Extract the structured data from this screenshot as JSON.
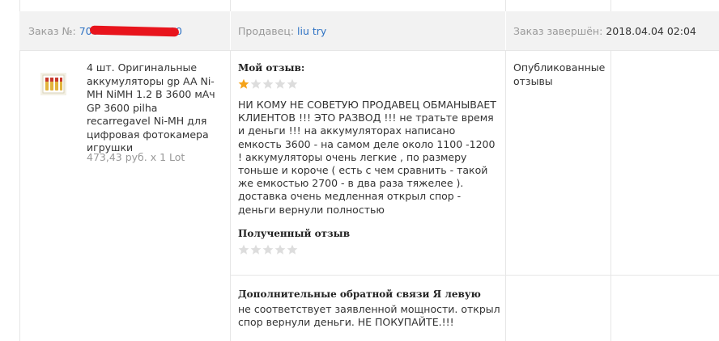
{
  "header": {
    "order_label": "Заказ №:",
    "order_number": "7000000000000000",
    "seller_label": "Продавец:",
    "seller_name": "liu try",
    "completed_label": "Заказ завершён:",
    "completed_date": "2018.04.04 02:04"
  },
  "product": {
    "icon": "battery-pack-thumbnail",
    "title": "4 шт. Оригинальные аккумуляторы gp AA Ni-MH NiMH 1.2 В 3600 мАч GP 3600 pilha recarregavel Ni-MH для цифровая фотокамера игрушки",
    "price": "473,43 руб. x 1 Lot"
  },
  "my_review": {
    "title": "Мой отзыв:",
    "rating": 1,
    "max_rating": 5,
    "text": "НИ КОМУ НЕ СОВЕТУЮ ПРОДАВЕЦ ОБМАНЫВАЕТ КЛИЕНТОВ !!! ЭТО РАЗВОД !!! не тратьте время и деньги !!! на аккумуляторах написано емкость 3600 - на самом деле около 1100 -1200 ! аккумуляторы очень легкие , по размеру тоньше и короче ( есть с чем сравнить - такой же емкостью 2700 - в два раза тяжелее ). доставка очень медленная открыл спор - деньги вернули полностью"
  },
  "received_review": {
    "title": "Полученный отзыв",
    "rating": 0,
    "max_rating": 5
  },
  "additional_feedback": {
    "title": "Дополнительные обратной связи Я левую",
    "text": "не соответствует заявленной мощности. открыл спор вернули деньги. НЕ ПОКУПАЙТЕ.!!!"
  },
  "status": {
    "text": "Опубликованные отзывы"
  },
  "colors": {
    "link": "#2f73c4",
    "star_filled": "#f5a31a",
    "star_empty": "#dddddd",
    "header_bg": "#f2f2f2",
    "muted_text": "#999999"
  }
}
